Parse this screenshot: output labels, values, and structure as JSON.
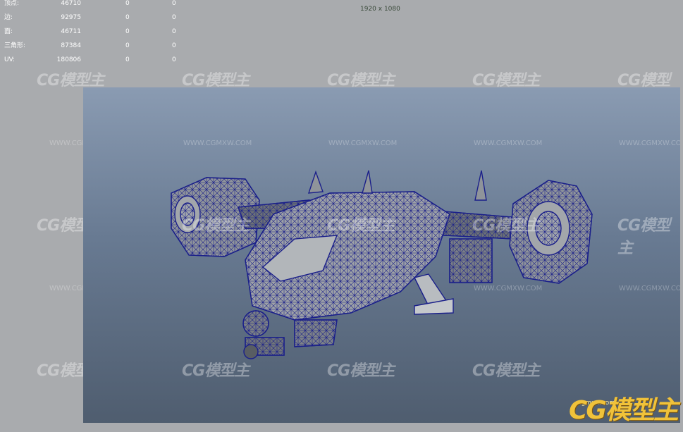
{
  "stats": [
    {
      "label": "顶点:",
      "v1": "46710",
      "v2": "0",
      "v3": "0"
    },
    {
      "label": "边:",
      "v1": "92975",
      "v2": "0",
      "v3": "0"
    },
    {
      "label": "面:",
      "v1": "46711",
      "v2": "0",
      "v3": "0"
    },
    {
      "label": "三角形:",
      "v1": "87384",
      "v2": "0",
      "v3": "0"
    },
    {
      "label": "UV:",
      "v1": "180806",
      "v2": "0",
      "v3": "0"
    }
  ],
  "resolution": "1920 x 1080",
  "watermark": {
    "logo_text": "CG模型主",
    "url_text": "WWW.CGMXW.COM"
  },
  "brand": {
    "url": "cgmxw.com",
    "logo": "CG模型主"
  },
  "colors": {
    "viewport_top": "#8a9bb2",
    "viewport_bottom": "#4f5d6f",
    "wireframe": "#1a1f8a",
    "brand": "#f0c23a"
  }
}
